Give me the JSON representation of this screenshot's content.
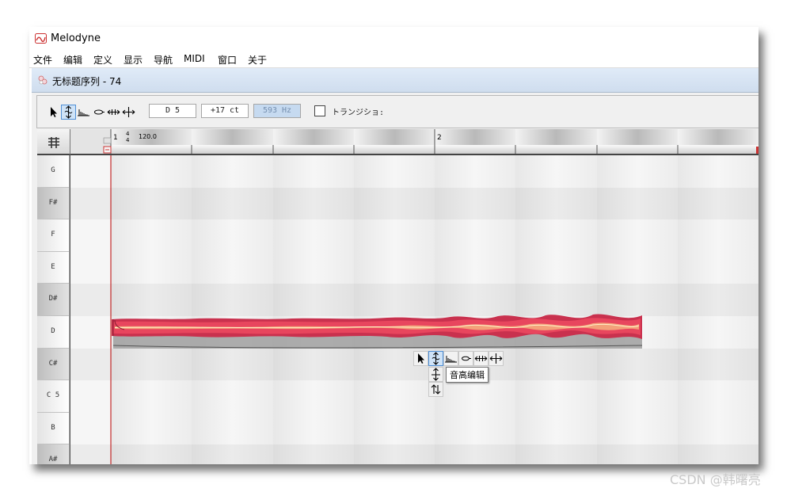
{
  "app": {
    "title": "Melodyne"
  },
  "menu": [
    "文件",
    "编辑",
    "定义",
    "显示",
    "导航",
    "MIDI",
    "窗口",
    "关于"
  ],
  "document": {
    "title": "无标题序列 - 74"
  },
  "toolbar": {
    "tools": [
      {
        "name": "main-tool",
        "icon": "arrow-pointer-icon",
        "active": false
      },
      {
        "name": "pitch-tool",
        "icon": "pitch-edit-icon",
        "active": true
      },
      {
        "name": "formant-tool",
        "icon": "formant-icon",
        "active": false
      },
      {
        "name": "amplitude-tool",
        "icon": "amplitude-icon",
        "active": false
      },
      {
        "name": "timing-tool",
        "icon": "timing-icon",
        "active": false
      },
      {
        "name": "separation-tool",
        "icon": "separation-icon",
        "active": false
      }
    ],
    "note_value": "D 5",
    "cents_value": "+17 ct",
    "hz_value": "593 Hz",
    "transition_label": "トランジショ:",
    "transition_checked": false
  },
  "ruler": {
    "bar1": "1",
    "time_sig_top": "4",
    "time_sig_bottom": "4",
    "tempo": "120.0",
    "bar2": "2"
  },
  "pitch_keys": [
    "G",
    "F#",
    "F",
    "E",
    "D#",
    "D",
    "C#",
    "C 5",
    "B",
    "A#"
  ],
  "note_blob": {
    "pitch": "D",
    "colors": {
      "outer": "#c9314e",
      "mid": "#e8465e",
      "inner": "#f3a27a"
    }
  },
  "floating_toolbox": {
    "tooltip": "音高编辑"
  },
  "watermark": "CSDN @韩曙亮"
}
